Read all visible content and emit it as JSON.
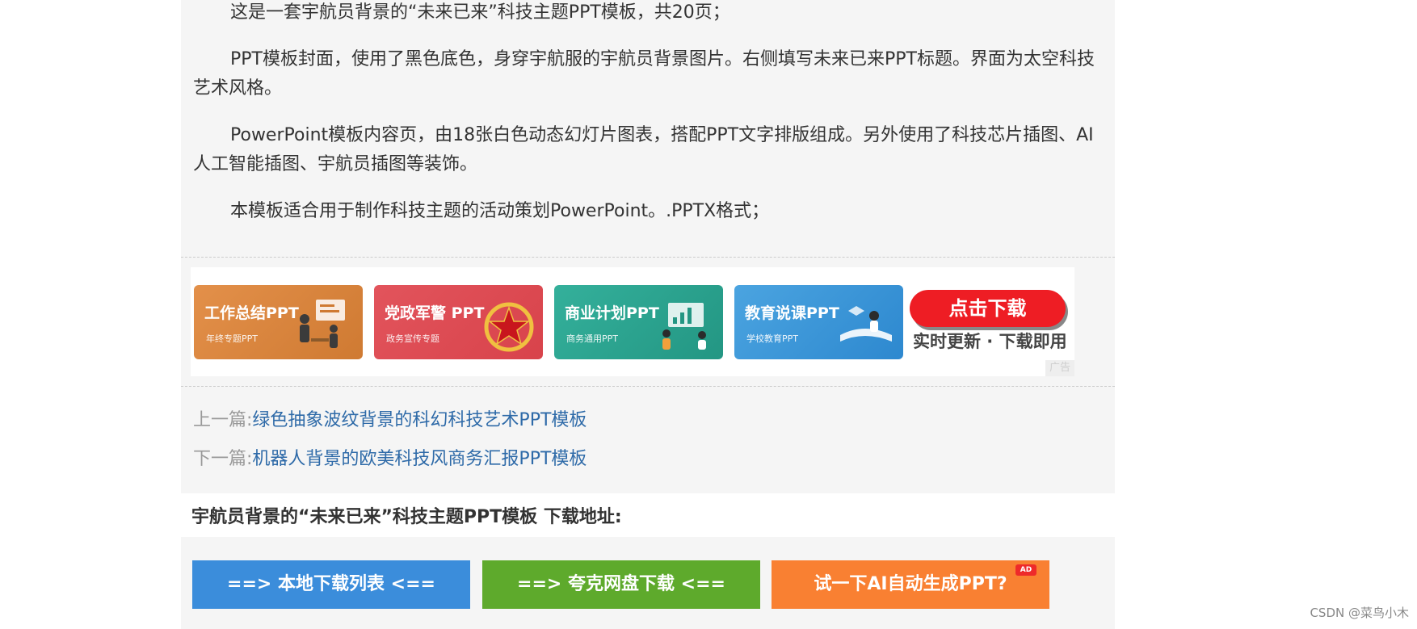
{
  "article": {
    "p1": "这是一套宇航员背景的“未来已来”科技主题PPT模板，共20页；",
    "p2": "PPT模板封面，使用了黑色底色，身穿宇航服的宇航员背景图片。右侧填写未来已来PPT标题。界面为太空科技艺术风格。",
    "p3": "PowerPoint模板内容页，由18张白色动态幻灯片图表，搭配PPT文字排版组成。另外使用了科技芯片插图、AI人工智能插图、宇航员插图等装饰。",
    "p4": "本模板适合用于制作科技主题的活动策划PowerPoint。.PPTX格式；"
  },
  "banner": {
    "cards": [
      {
        "title": "工作总结PPT",
        "subtitle": "年终专题PPT",
        "color": "#d8843e",
        "icon": "office-meeting-illustration"
      },
      {
        "title": "党政军警 PPT",
        "subtitle": "政务宣传专题",
        "color": "#dd4b53",
        "icon": "red-star-emblem"
      },
      {
        "title": "商业计划PPT",
        "subtitle": "商务通用PPT",
        "color": "#2ba38e",
        "icon": "business-chart-illustration"
      },
      {
        "title": "教育说课PPT",
        "subtitle": "学校教育PPT",
        "color": "#3a96d8",
        "icon": "education-book-illustration"
      }
    ],
    "download_label": "点击下载",
    "download_sub": "实时更新 · 下载即用",
    "ad_label": "广告"
  },
  "nav": {
    "prev_label": "上一篇:",
    "prev_title": "绿色抽象波纹背景的科幻科技艺术PPT模板",
    "next_label": "下一篇:",
    "next_title": "机器人背景的欧美科技风商务汇报PPT模板"
  },
  "download": {
    "title": "宇航员背景的“未来已来”科技主题PPT模板 下载地址:",
    "buttons": {
      "local": "==> 本地下载列表 <==",
      "quark": "==> 夸克网盘下载 <==",
      "ai": "试一下AI自动生成PPT?",
      "ai_badge": "AD"
    }
  },
  "watermark": "CSDN @菜鸟小木"
}
